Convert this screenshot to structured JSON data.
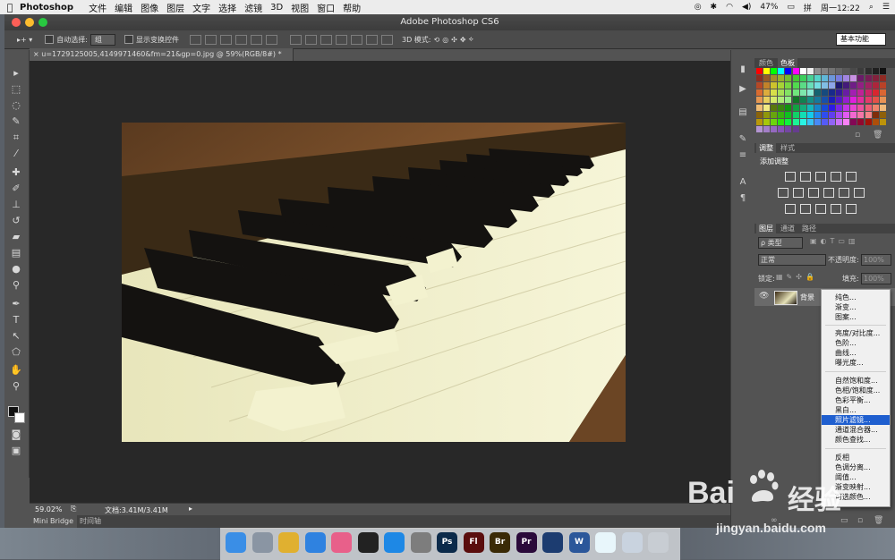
{
  "menubar": {
    "app_name": "Photoshop",
    "items": [
      "文件",
      "编辑",
      "图像",
      "图层",
      "文字",
      "选择",
      "滤镜",
      "3D",
      "视图",
      "窗口",
      "帮助"
    ],
    "battery": "47%",
    "clock": "周一12:22"
  },
  "window": {
    "title": "Adobe Photoshop CS6"
  },
  "options": {
    "auto_select_label": "自动选择:",
    "auto_select_value": "组",
    "show_transform_label": "显示变换控件",
    "mode_3d_label": "3D 模式:",
    "workspace": "基本功能"
  },
  "document": {
    "tab_label": "u=1729125005,4149971460&fm=21&gp=0.jpg @ 59%(RGB/8#) *",
    "zoom": "59.02%",
    "doc_info": "文档:3.41M/3.41M"
  },
  "bottom_tabs": [
    "Mini Bridge",
    "时间轴"
  ],
  "panels": {
    "color_tabs": [
      "颜色",
      "色板"
    ],
    "adjust_tabs": [
      "调整",
      "样式"
    ],
    "adjust_title": "添加调整",
    "layer_tabs": [
      "图层",
      "通道",
      "路径"
    ],
    "filter_kind": "ρ 类型",
    "blend_mode": "正常",
    "opacity_label": "不透明度:",
    "opacity_value": "100%",
    "lock_label": "锁定:",
    "fill_label": "填充:",
    "fill_value": "100%",
    "layer_name": "背景"
  },
  "context_menu": {
    "groups": [
      [
        "纯色...",
        "渐变...",
        "图案..."
      ],
      [
        "亮度/对比度...",
        "色阶...",
        "曲线...",
        "曝光度..."
      ],
      [
        "自然饱和度...",
        "色相/饱和度...",
        "色彩平衡...",
        "黑白...",
        "照片滤镜...",
        "通道混合器...",
        "颜色查找..."
      ],
      [
        "反相",
        "色调分离...",
        "阈值...",
        "渐变映射...",
        "可选颜色..."
      ]
    ],
    "highlighted": "照片滤镜..."
  },
  "dock": {
    "apps": [
      {
        "name": "finder-icon",
        "label": "",
        "color": "#3a8ee6"
      },
      {
        "name": "launchpad-icon",
        "label": "",
        "color": "#8a95a3"
      },
      {
        "name": "chrome-icon",
        "label": "",
        "color": "#e0b030"
      },
      {
        "name": "safari-icon",
        "label": "",
        "color": "#2f82e0"
      },
      {
        "name": "photos-icon",
        "label": "",
        "color": "#e8608a"
      },
      {
        "name": "qq-icon",
        "label": "",
        "color": "#222222"
      },
      {
        "name": "app-store-icon",
        "label": "",
        "color": "#1e88e5"
      },
      {
        "name": "system-preferences-icon",
        "label": "",
        "color": "#7d7d7d"
      },
      {
        "name": "photoshop-icon",
        "label": "Ps",
        "color": "#0b2a4a"
      },
      {
        "name": "flash-icon",
        "label": "Fl",
        "color": "#5a0d0d"
      },
      {
        "name": "bridge-icon",
        "label": "Br",
        "color": "#3a2a06"
      },
      {
        "name": "premiere-icon",
        "label": "Pr",
        "color": "#2a0a3a"
      },
      {
        "name": "quicktime-icon",
        "label": "",
        "color": "#1c3c70"
      },
      {
        "name": "word-icon",
        "label": "W",
        "color": "#2b579a"
      },
      {
        "name": "wunderlist-icon",
        "label": "",
        "color": "#e8f6fb"
      },
      {
        "name": "mail-icon",
        "label": "",
        "color": "#c9d3df"
      },
      {
        "name": "trash-icon",
        "label": "",
        "color": "#c8cdd3"
      }
    ]
  },
  "watermark": {
    "brand": "Bai",
    "brand2": "经验",
    "url": "jingyan.baidu.com"
  }
}
